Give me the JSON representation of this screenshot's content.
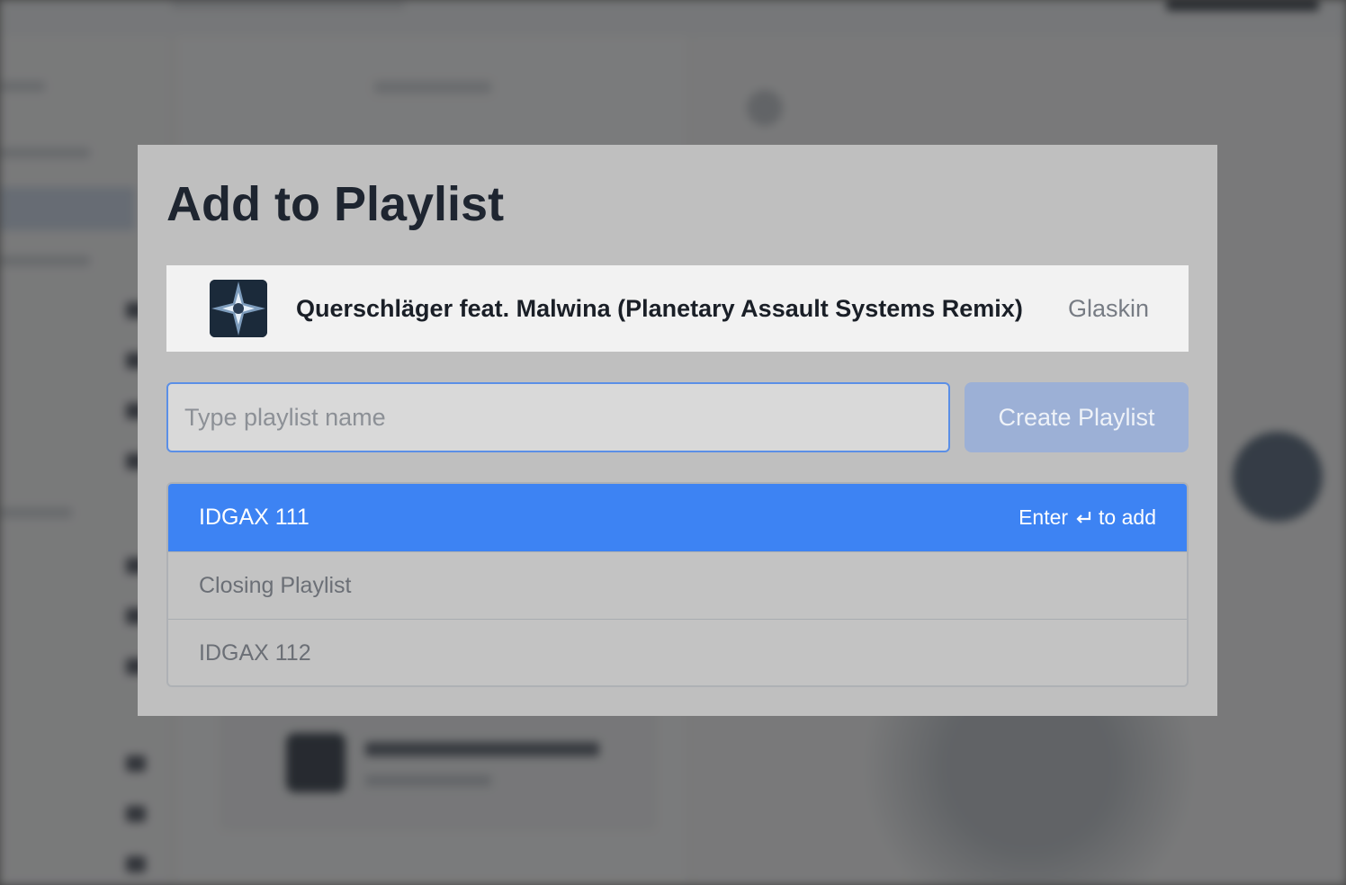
{
  "modal": {
    "title": "Add to Playlist",
    "track": {
      "title": "Querschläger feat. Malwina (Planetary Assault Systems Remix)",
      "artist": "Glaskin",
      "art_icon": "album-art-icon"
    },
    "input": {
      "value": "",
      "placeholder": "Type playlist name"
    },
    "create_button_label": "Create Playlist",
    "playlists": [
      {
        "name": "IDGAX 111",
        "selected": true
      },
      {
        "name": "Closing Playlist",
        "selected": false
      },
      {
        "name": "IDGAX 112",
        "selected": false
      }
    ],
    "selected_hint": {
      "prefix": "Enter",
      "icon": "return-key-icon",
      "suffix": "to add"
    }
  },
  "colors": {
    "accent": "#3d83f3",
    "create_button": "#9cb0d6",
    "input_border": "#5b8fe6"
  }
}
